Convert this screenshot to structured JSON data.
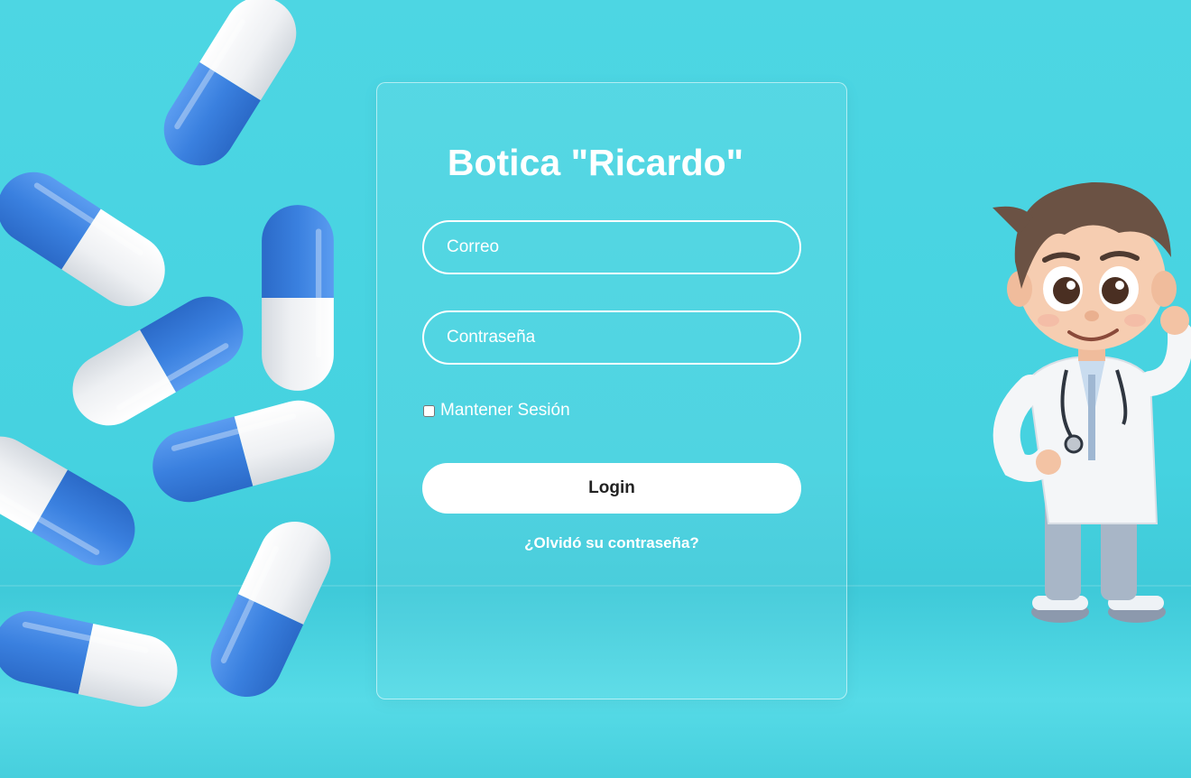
{
  "app": {
    "title": "Botica \"Ricardo\""
  },
  "form": {
    "email_placeholder": "Correo",
    "email_value": "",
    "password_placeholder": "Contraseña",
    "password_value": "",
    "remember_label": "Mantener Sesión",
    "remember_checked": false,
    "login_label": "Login",
    "forgot_label": "¿Olvidó su contraseña?"
  },
  "theme": {
    "background": "#4dd6e3",
    "text": "#ffffff",
    "button_bg": "#ffffff",
    "button_text": "#222222",
    "capsule_blue": "#3a86e0",
    "capsule_white": "#f2f4f6"
  },
  "decor": {
    "left_image": "blue-white-capsules",
    "right_image": "cartoon-pharmacist-doctor"
  }
}
